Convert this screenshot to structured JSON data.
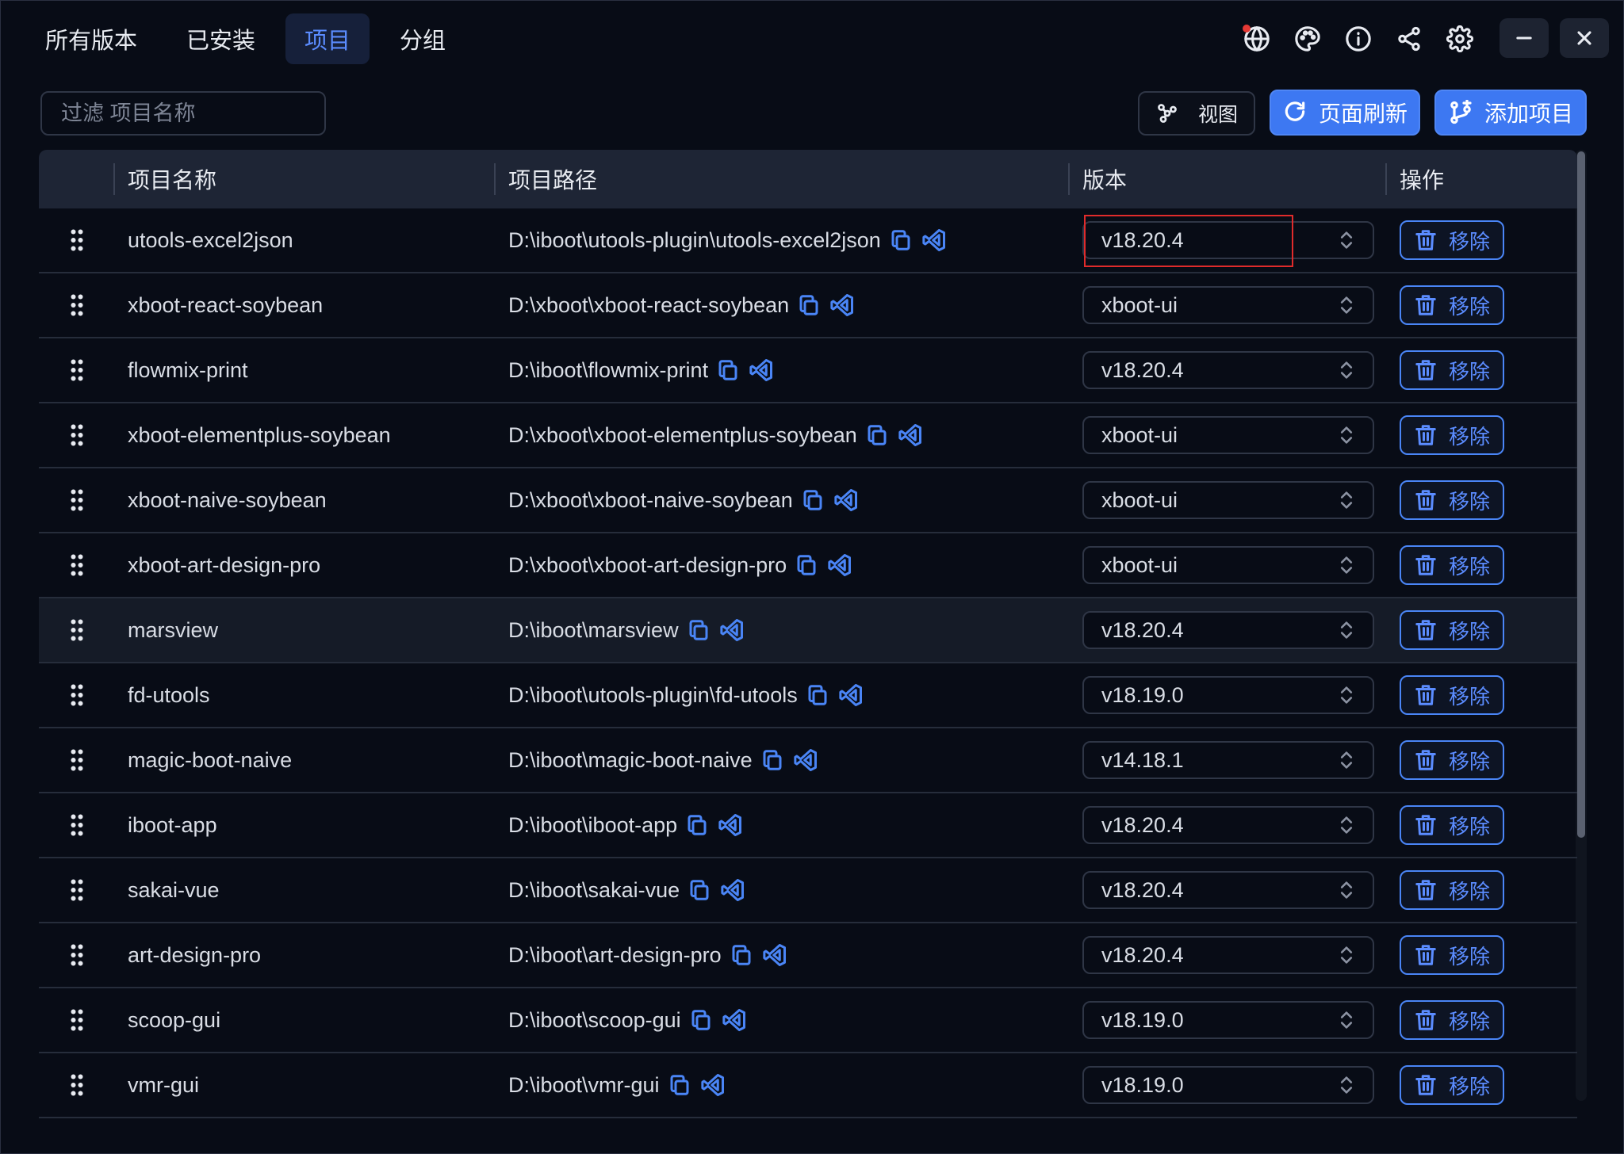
{
  "tabs": [
    {
      "label": "所有版本",
      "active": false
    },
    {
      "label": "已安装",
      "active": false
    },
    {
      "label": "项目",
      "active": true
    },
    {
      "label": "分组",
      "active": false
    }
  ],
  "toolbar": {
    "filter_placeholder": "过滤 项目名称",
    "view_label": "视图",
    "refresh_label": "页面刷新",
    "add_label": "添加项目"
  },
  "colors": {
    "accent": "#3d78f2",
    "link_icon": "#4a85f6",
    "highlight_box": "#e02b2b",
    "notification_dot": "#e53935"
  },
  "table": {
    "headers": {
      "name": "项目名称",
      "path": "项目路径",
      "version": "版本",
      "action": "操作"
    },
    "remove_label": "移除",
    "rows": [
      {
        "name": "utools-excel2json",
        "path": "D:\\iboot\\utools-plugin\\utools-excel2json",
        "version": "v18.20.4"
      },
      {
        "name": "xboot-react-soybean",
        "path": "D:\\xboot\\xboot-react-soybean",
        "version": "xboot-ui"
      },
      {
        "name": "flowmix-print",
        "path": "D:\\iboot\\flowmix-print",
        "version": "v18.20.4"
      },
      {
        "name": "xboot-elementplus-soybean",
        "path": "D:\\xboot\\xboot-elementplus-soybean",
        "version": "xboot-ui"
      },
      {
        "name": "xboot-naive-soybean",
        "path": "D:\\xboot\\xboot-naive-soybean",
        "version": "xboot-ui"
      },
      {
        "name": "xboot-art-design-pro",
        "path": "D:\\xboot\\xboot-art-design-pro",
        "version": "xboot-ui"
      },
      {
        "name": "marsview",
        "path": "D:\\iboot\\marsview",
        "version": "v18.20.4",
        "hovered": true
      },
      {
        "name": "fd-utools",
        "path": "D:\\iboot\\utools-plugin\\fd-utools",
        "version": "v18.19.0"
      },
      {
        "name": "magic-boot-naive",
        "path": "D:\\iboot\\magic-boot-naive",
        "version": "v14.18.1"
      },
      {
        "name": "iboot-app",
        "path": "D:\\iboot\\iboot-app",
        "version": "v18.20.4"
      },
      {
        "name": "sakai-vue",
        "path": "D:\\iboot\\sakai-vue",
        "version": "v18.20.4"
      },
      {
        "name": "art-design-pro",
        "path": "D:\\iboot\\art-design-pro",
        "version": "v18.20.4"
      },
      {
        "name": "scoop-gui",
        "path": "D:\\iboot\\scoop-gui",
        "version": "v18.19.0"
      },
      {
        "name": "vmr-gui",
        "path": "D:\\iboot\\vmr-gui",
        "version": "v18.19.0"
      }
    ]
  },
  "icons": {
    "top": [
      "globe-icon",
      "palette-icon",
      "info-icon",
      "share-icon",
      "gear-icon"
    ],
    "window": [
      "minimize-icon",
      "close-icon"
    ]
  }
}
